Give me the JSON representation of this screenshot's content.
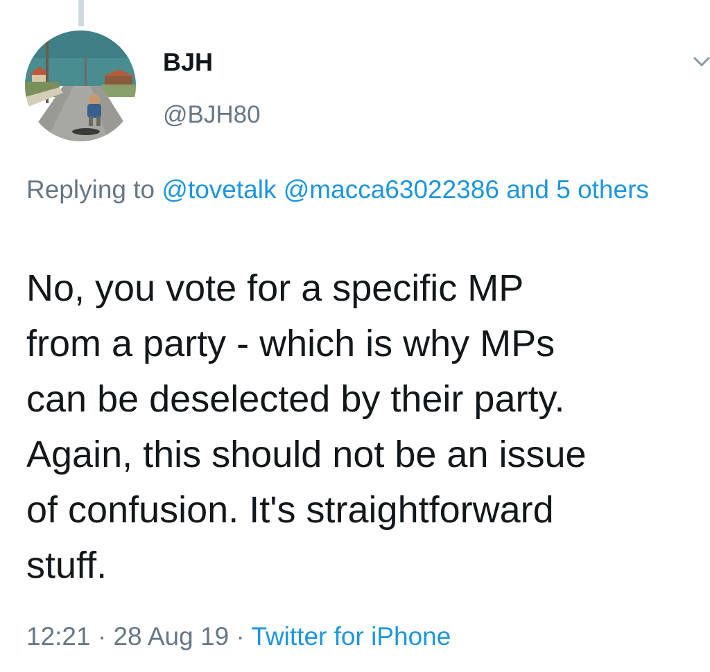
{
  "thread": {
    "connector_color": "#cfd9de"
  },
  "author": {
    "display_name": "BJH",
    "handle": "@BJH80",
    "avatar_icon": "avatar-photo-child-on-street-by-sea"
  },
  "menu": {
    "icon": "chevron-down-icon"
  },
  "reply_context": {
    "prefix": "Replying to",
    "mentions": [
      "@tovetalk",
      "@macca63022386"
    ],
    "others": "and 5 others"
  },
  "tweet": {
    "lines": [
      "No, you vote for a specific MP",
      "from a party - which is why MPs",
      "can be deselected by their party.",
      "Again, this should not be an issue",
      "of confusion. It's straightforward",
      "stuff."
    ]
  },
  "meta": {
    "time": "12:21",
    "separator": "·",
    "date": "28 Aug 19",
    "source": "Twitter for iPhone"
  },
  "colors": {
    "text": "#14171a",
    "secondary": "#657786",
    "link": "#1b95e0"
  }
}
